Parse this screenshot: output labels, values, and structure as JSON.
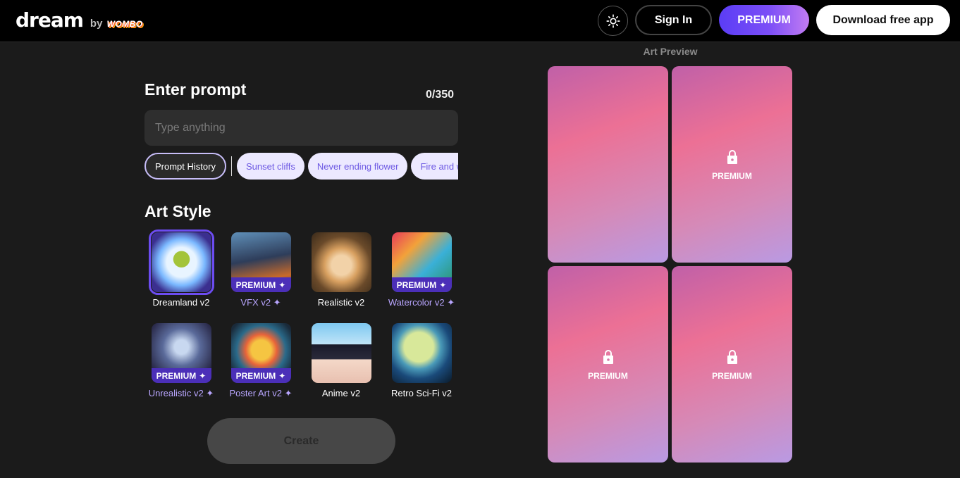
{
  "header": {
    "logo": "dream",
    "logo_by": "by",
    "logo_brand": "WOMBO",
    "theme_icon": "sun-icon",
    "signin_label": "Sign In",
    "premium_label": "PREMIUM",
    "download_label": "Download free app",
    "accent_color": "#6c4cf1"
  },
  "prompt": {
    "title": "Enter prompt",
    "char_count": "0/350",
    "value": "",
    "placeholder": "Type anything",
    "history_label": "Prompt History",
    "suggestions": [
      "Sunset cliffs",
      "Never ending flower",
      "Fire and water"
    ]
  },
  "art_style": {
    "title": "Art Style",
    "premium_tag": "PREMIUM",
    "styles": [
      {
        "label": "Dreamland v2",
        "premium": false,
        "selected": true
      },
      {
        "label": "VFX v2",
        "premium": true,
        "selected": false
      },
      {
        "label": "Realistic v2",
        "premium": false,
        "selected": false
      },
      {
        "label": "Watercolor v2",
        "premium": true,
        "selected": false
      },
      {
        "label": "Unrealistic v2",
        "premium": true,
        "selected": false
      },
      {
        "label": "Poster Art v2",
        "premium": true,
        "selected": false
      },
      {
        "label": "Anime v2",
        "premium": false,
        "selected": false
      },
      {
        "label": "Retro Sci-Fi v2",
        "premium": false,
        "selected": false
      }
    ]
  },
  "create_label": "Create",
  "preview": {
    "title": "Art Preview",
    "cards": [
      {
        "locked": false,
        "label": ""
      },
      {
        "locked": true,
        "label": "PREMIUM"
      },
      {
        "locked": true,
        "label": "PREMIUM"
      },
      {
        "locked": true,
        "label": "PREMIUM"
      }
    ]
  }
}
